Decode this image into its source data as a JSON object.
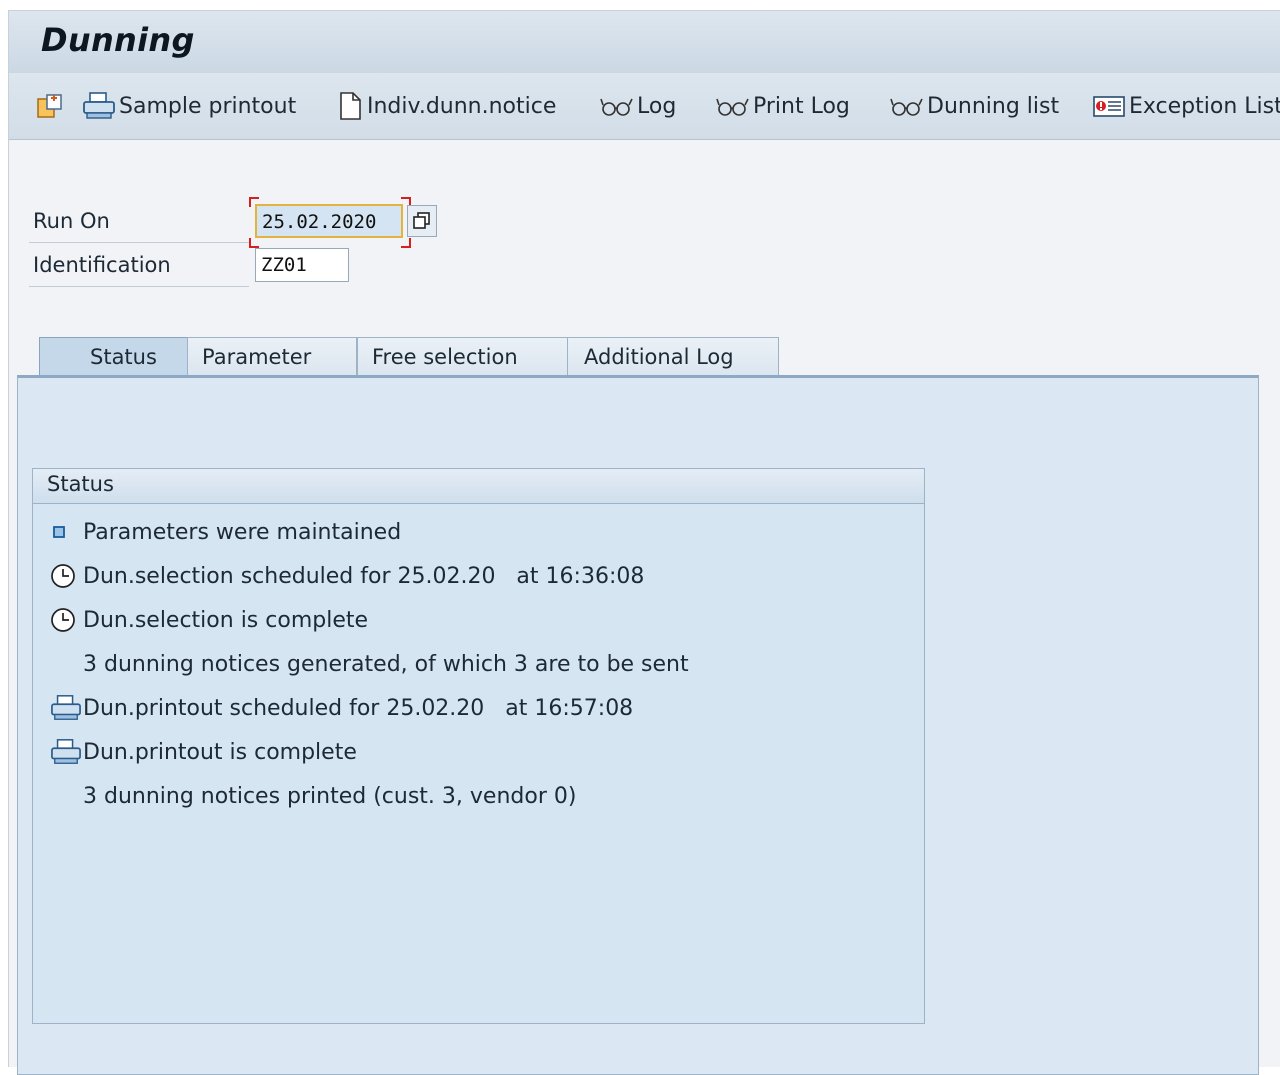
{
  "window": {
    "title": "Dunning"
  },
  "toolbar": {
    "sample_printout": "Sample printout",
    "indiv_dunn_notice": "Indiv.dunn.notice",
    "log": "Log",
    "print_log": "Print Log",
    "dunning_list": "Dunning list",
    "exception_list": "Exception List"
  },
  "fields": {
    "run_on": {
      "label": "Run On",
      "value": "25.02.2020"
    },
    "identification": {
      "label": "Identification",
      "value": "ZZ01"
    }
  },
  "tabs": [
    {
      "label": "Status",
      "active": true
    },
    {
      "label": "Parameter"
    },
    {
      "label": "Free selection"
    },
    {
      "label": "Additional Log"
    }
  ],
  "status_group": {
    "title": "Status",
    "lines": [
      {
        "icon": "square-bullet-icon",
        "text": "Parameters were maintained"
      },
      {
        "icon": "clock-icon",
        "text": "Dun.selection scheduled for 25.02.20   at 16:36:08"
      },
      {
        "icon": "clock-icon",
        "text": "Dun.selection is complete"
      },
      {
        "icon": "",
        "text": "3 dunning notices generated, of which 3 are to be sent"
      },
      {
        "icon": "printer-icon",
        "text": "Dun.printout scheduled for 25.02.20   at 16:57:08"
      },
      {
        "icon": "printer-icon",
        "text": "Dun.printout is complete"
      },
      {
        "icon": "",
        "text": "3 dunning notices printed (cust. 3, vendor 0)"
      }
    ]
  },
  "colors": {
    "accent": "#1a6fc0",
    "focus_border": "#e2b33d",
    "required_marker": "#d42020"
  }
}
